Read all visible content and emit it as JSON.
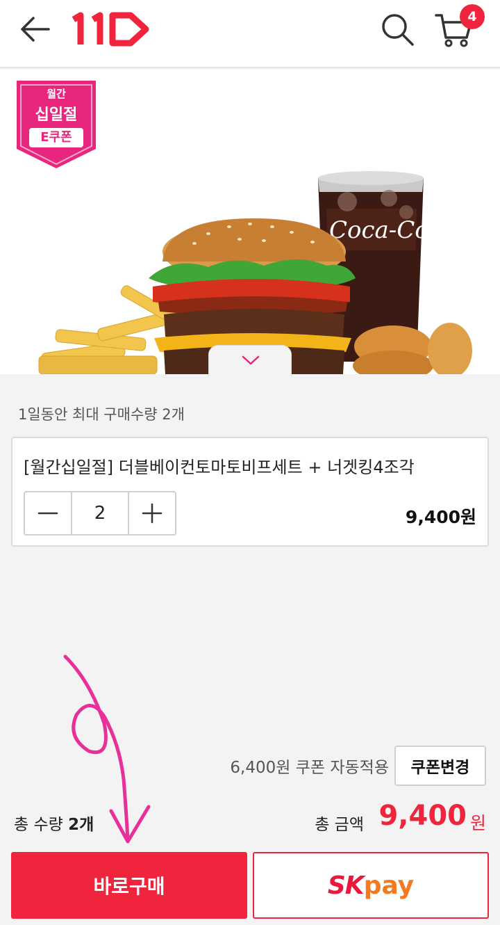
{
  "header": {
    "logo_text": "11",
    "cart_count": "4"
  },
  "promo_badge": {
    "line1": "월간",
    "line2": "십일절",
    "line3": "E쿠폰"
  },
  "product_image": {
    "drink_brand": "Coca-Cola"
  },
  "purchase_limit": "1일동안 최대 구매수량 2개",
  "option": {
    "title": "[월간십일절] 더블베이컨토마토비프세트 + 너겟킹4조각",
    "quantity": "2",
    "price": "9,400원"
  },
  "coupon": {
    "text": "6,400원 쿠폰 자동적용",
    "change_label": "쿠폰변경"
  },
  "totals": {
    "qty_label": "총 수량",
    "qty_value": "2개",
    "amount_label": "총 금액",
    "amount_value": "9,400",
    "amount_unit": "원"
  },
  "actions": {
    "buy_now": "바로구매",
    "skpay_sk": "SK",
    "skpay_pay": "pay"
  },
  "colors": {
    "accent": "#f0243c",
    "badge_pink": "#e8267e",
    "annotation_pink": "#e8309a"
  }
}
